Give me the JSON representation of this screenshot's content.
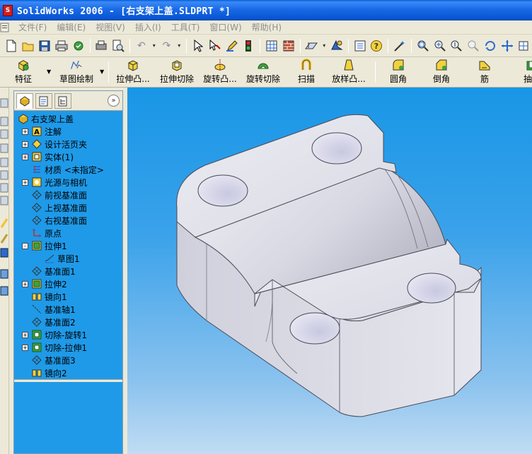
{
  "window": {
    "title": "SolidWorks 2006 - [右支架上盖.SLDPRT *]"
  },
  "menu": {
    "items": [
      "文件(F)",
      "编辑(E)",
      "视图(V)",
      "插入(I)",
      "工具(T)",
      "窗口(W)",
      "帮助(H)"
    ]
  },
  "feature_toolbar": {
    "buttons": [
      {
        "label": "特征",
        "icon": "feature-icon"
      },
      {
        "label": "草图绘制",
        "icon": "sketch-icon"
      },
      {
        "label": "拉伸凸...",
        "icon": "extrude-boss-icon"
      },
      {
        "label": "拉伸切除",
        "icon": "extrude-cut-icon"
      },
      {
        "label": "旋转凸...",
        "icon": "revolve-boss-icon"
      },
      {
        "label": "旋转切除",
        "icon": "revolve-cut-icon"
      },
      {
        "label": "扫描",
        "icon": "sweep-icon"
      },
      {
        "label": "放样凸...",
        "icon": "loft-icon"
      },
      {
        "label": "圆角",
        "icon": "fillet-icon"
      },
      {
        "label": "倒角",
        "icon": "chamfer-icon"
      },
      {
        "label": "筋",
        "icon": "rib-icon"
      },
      {
        "label": "抽壳",
        "icon": "shell-icon"
      }
    ]
  },
  "feature_tree": {
    "root": "右支架上盖",
    "items": [
      {
        "label": "注解",
        "expander": "+",
        "indent": 1
      },
      {
        "label": "设计活页夹",
        "expander": "+",
        "indent": 1
      },
      {
        "label": "实体(1)",
        "expander": "+",
        "indent": 1
      },
      {
        "label": "材质 <未指定>",
        "expander": "",
        "indent": 1
      },
      {
        "label": "光源与相机",
        "expander": "+",
        "indent": 1
      },
      {
        "label": "前视基准面",
        "expander": "",
        "indent": 1
      },
      {
        "label": "上视基准面",
        "expander": "",
        "indent": 1
      },
      {
        "label": "右视基准面",
        "expander": "",
        "indent": 1
      },
      {
        "label": "原点",
        "expander": "",
        "indent": 1
      },
      {
        "label": "拉伸1",
        "expander": "-",
        "indent": 1
      },
      {
        "label": "草图1",
        "expander": "",
        "indent": 2
      },
      {
        "label": "基准面1",
        "expander": "",
        "indent": 1
      },
      {
        "label": "拉伸2",
        "expander": "+",
        "indent": 1
      },
      {
        "label": "镜向1",
        "expander": "",
        "indent": 1
      },
      {
        "label": "基准轴1",
        "expander": "",
        "indent": 1
      },
      {
        "label": "基准面2",
        "expander": "",
        "indent": 1
      },
      {
        "label": "切除-旋转1",
        "expander": "+",
        "indent": 1
      },
      {
        "label": "切除-拉伸1",
        "expander": "+",
        "indent": 1
      },
      {
        "label": "基准面3",
        "expander": "",
        "indent": 1
      },
      {
        "label": "镜向2",
        "expander": "",
        "indent": 1
      }
    ]
  },
  "colors": {
    "title_bar": "#0a5fd8",
    "tree_background": "#1f9ae8",
    "viewport_top": "#1896e6",
    "viewport_bottom": "#c1dcf3",
    "part_face_light": "#e6e6ee",
    "part_face_dark": "#b8b8c8"
  }
}
